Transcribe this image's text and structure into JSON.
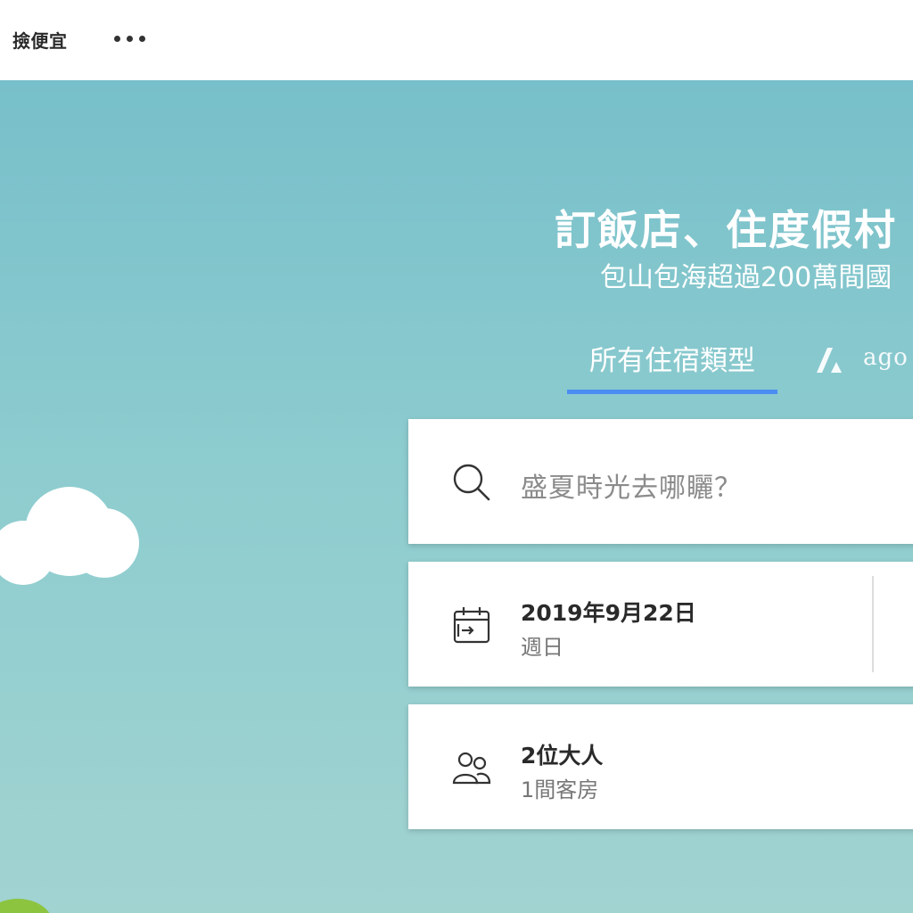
{
  "header": {
    "site_name": "撿便宜",
    "more_icon": "more-dots-icon"
  },
  "hero": {
    "headline": "訂飯店、住度假村",
    "subline": "包山包海超過200萬間國",
    "tabs": [
      {
        "label": "所有住宿類型",
        "active": true
      },
      {
        "label": "ago",
        "icon": "agoda-logo-icon",
        "active": false
      }
    ]
  },
  "search": {
    "icon": "search-icon",
    "placeholder": "盛夏時光去哪矖？"
  },
  "dates": {
    "icon": "calendar-checkin-icon",
    "checkin_date": "2019年9月22日",
    "checkin_weekday": "週日"
  },
  "guests": {
    "icon": "people-icon",
    "adults": "2位大人",
    "rooms": "1間客房"
  },
  "colors": {
    "hero_top": "#77bfca",
    "hero_bottom": "#a1d3d1",
    "tab_underline": "#4b8df2",
    "card_bg": "#ffffff"
  }
}
